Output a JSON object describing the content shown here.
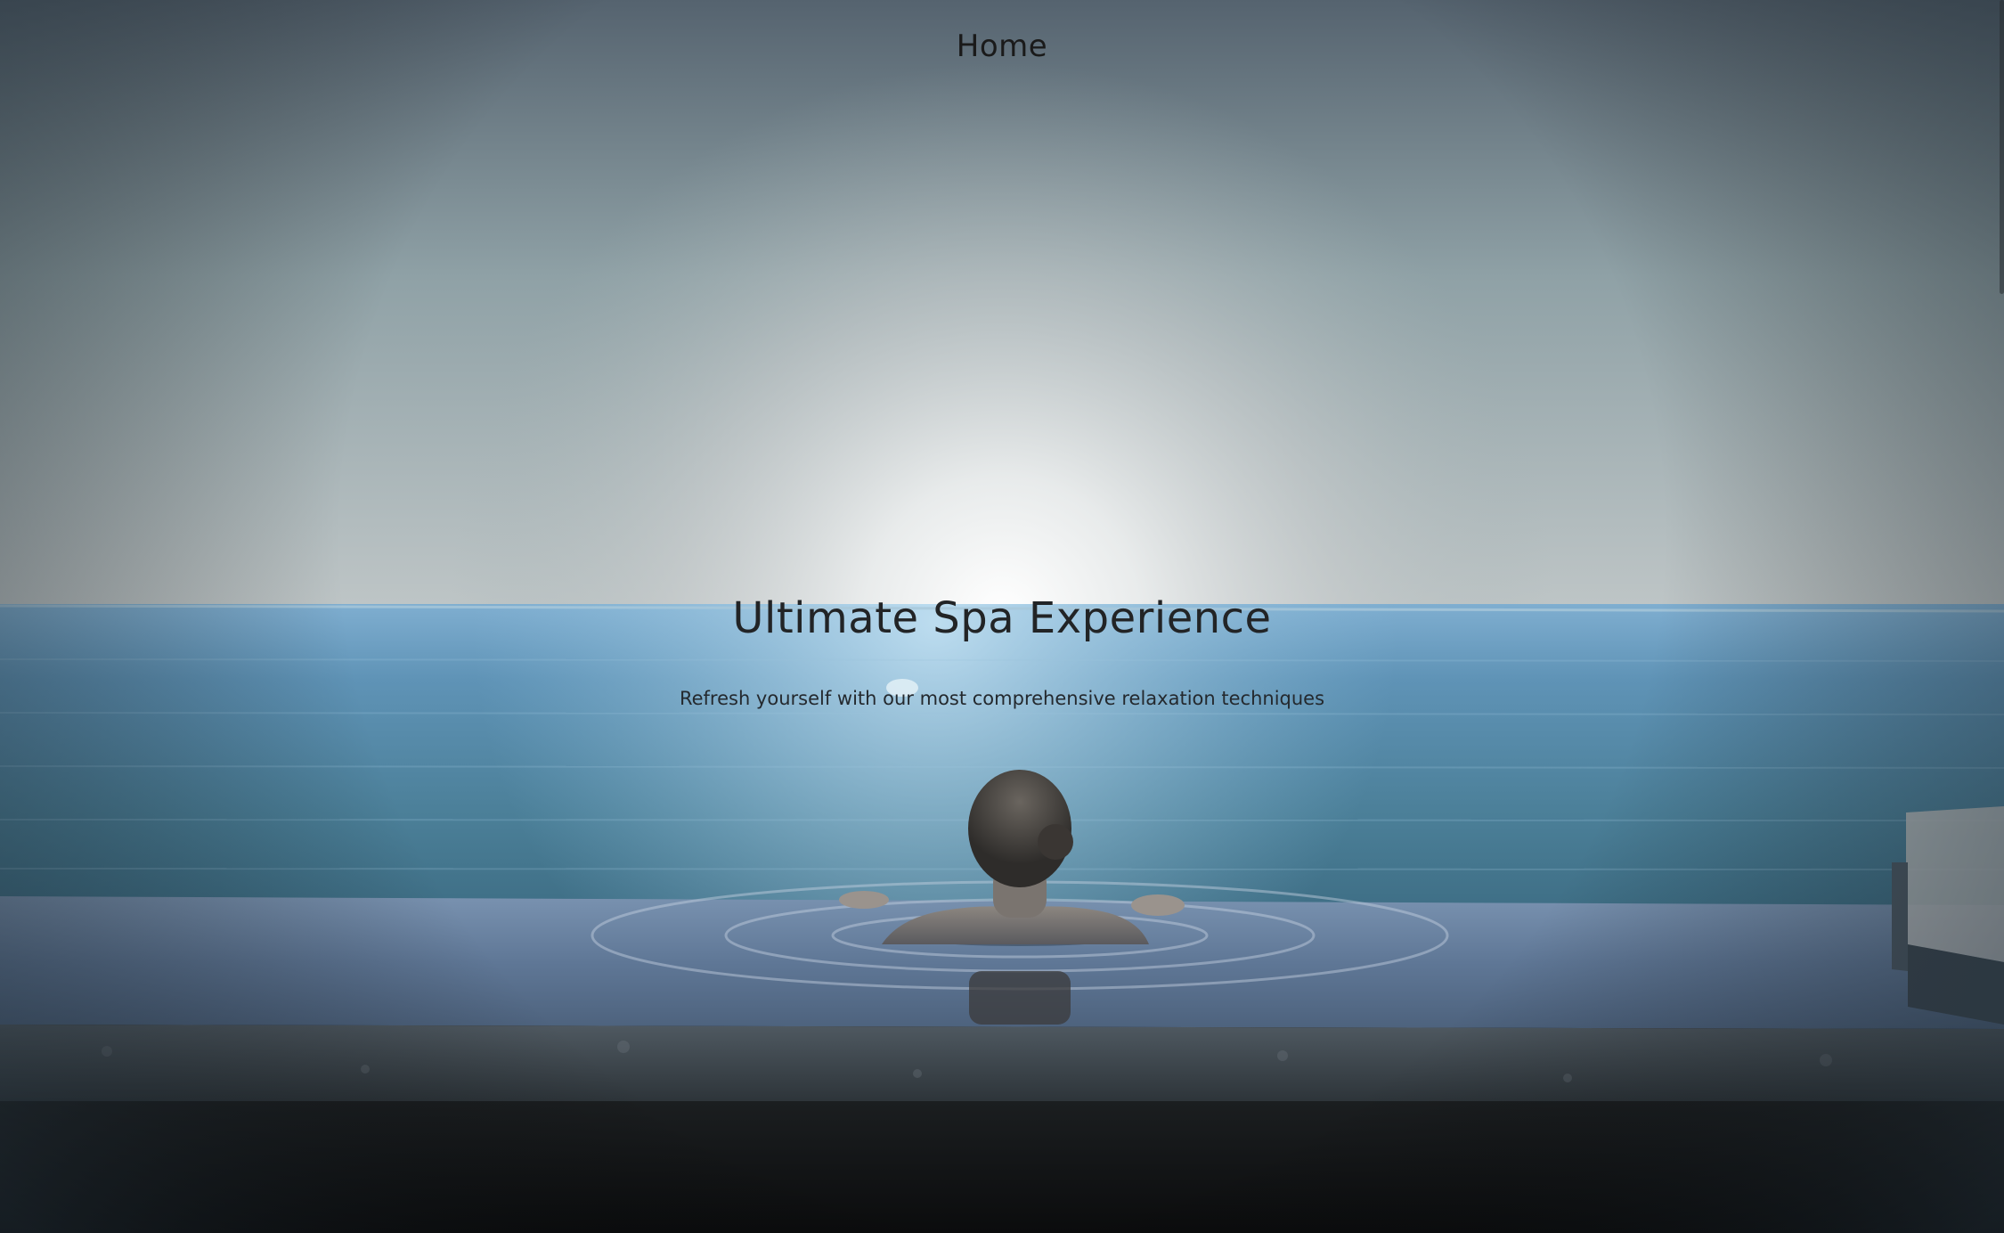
{
  "nav": {
    "home_label": "Home"
  },
  "hero": {
    "title": "Ultimate Spa Experience",
    "subtitle": "Refresh yourself with our most comprehensive relaxation techniques"
  },
  "colors": {
    "sky_top": "#5b6a75",
    "sky_glow": "#f2f4f4",
    "sea": "#5d8fae",
    "pool": "#6f8aa8",
    "pool_edge": "#3b444b",
    "ground": "#101112"
  }
}
